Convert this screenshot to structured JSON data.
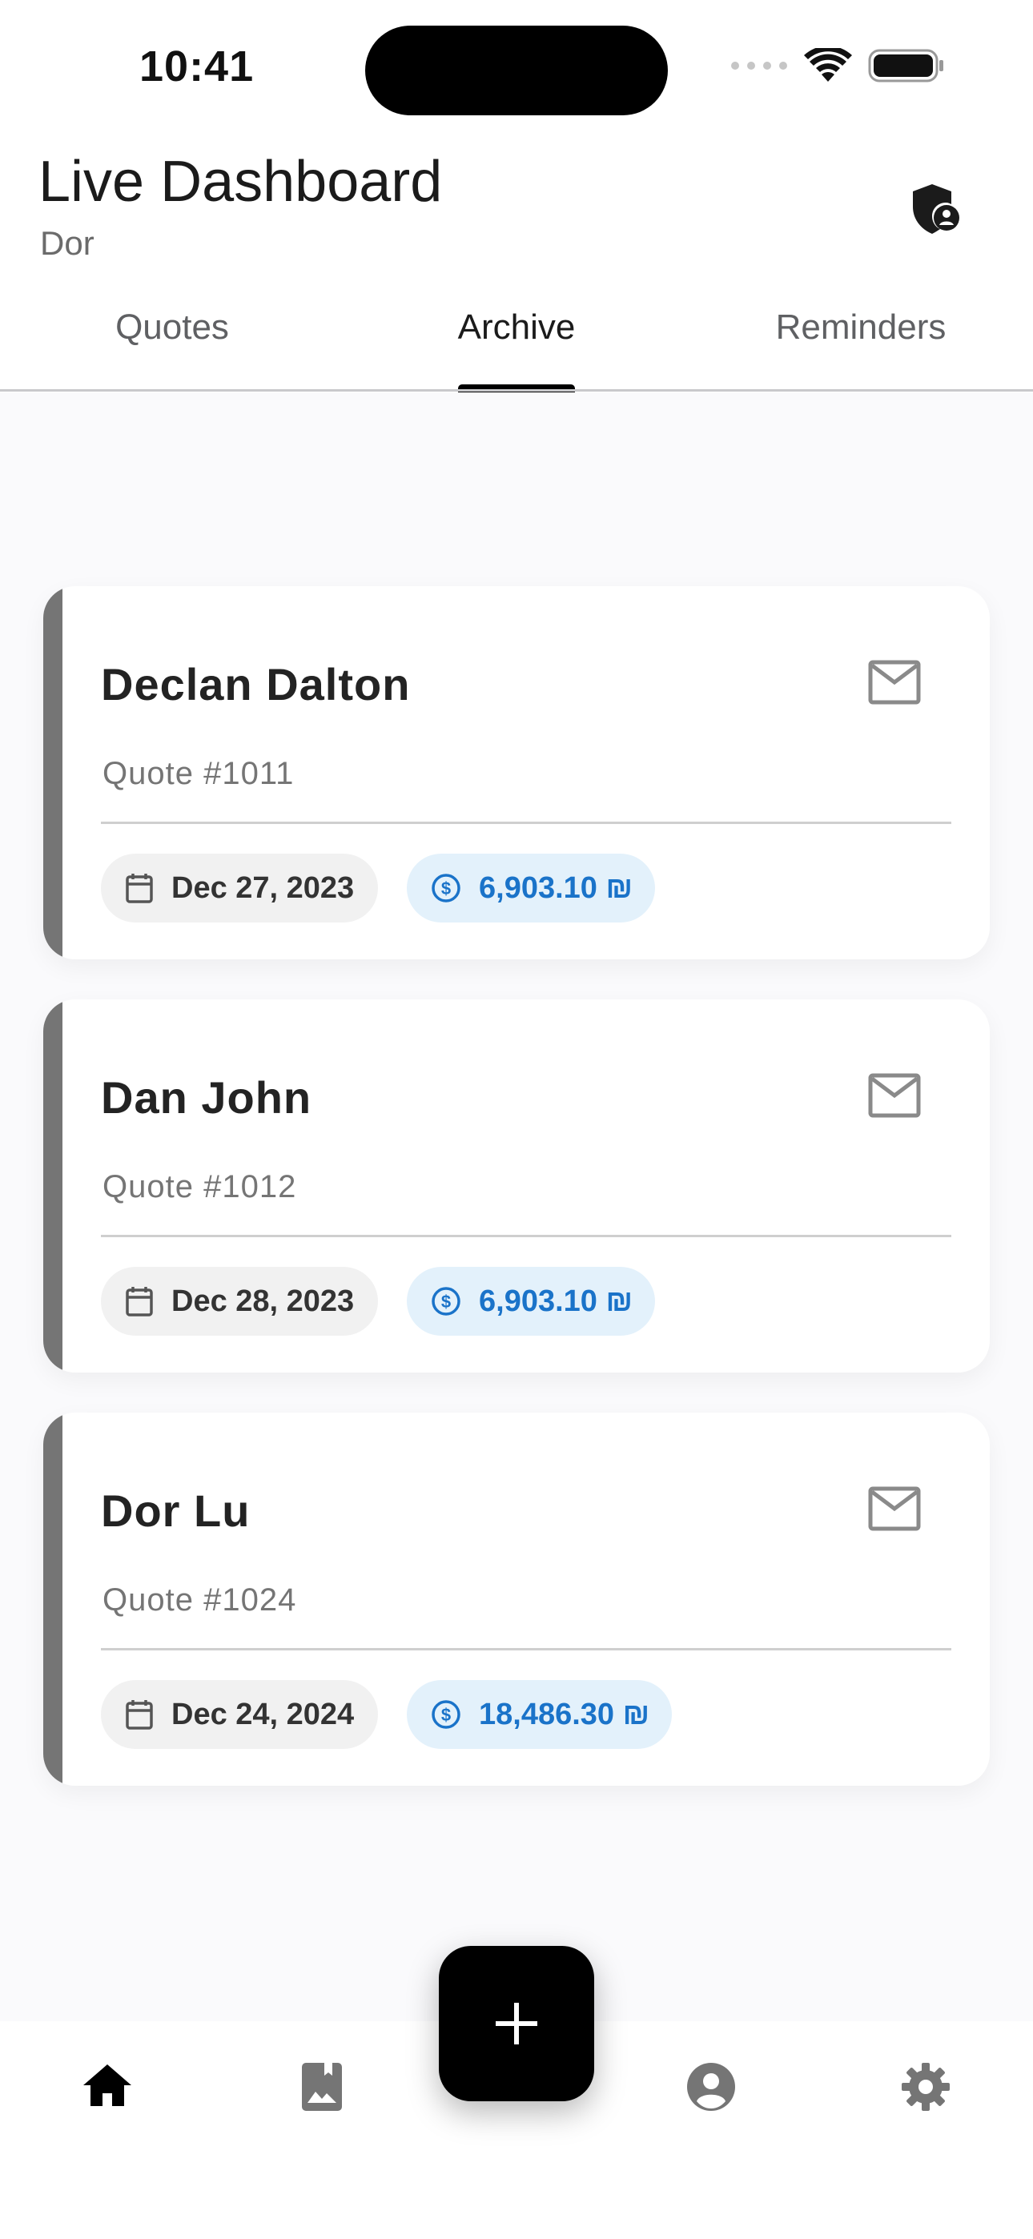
{
  "status_bar": {
    "time": "10:41"
  },
  "header": {
    "title": "Live Dashboard",
    "subtitle": "Dor"
  },
  "tabs": [
    {
      "label": "Quotes",
      "active": false
    },
    {
      "label": "Archive",
      "active": true
    },
    {
      "label": "Reminders",
      "active": false
    }
  ],
  "quotes": [
    {
      "name": "Declan Dalton",
      "quote_number": "Quote #1011",
      "date": "Dec 27, 2023",
      "amount": "6,903.10 ₪"
    },
    {
      "name": "Dan John",
      "quote_number": "Quote #1012",
      "date": "Dec 28, 2023",
      "amount": "6,903.10 ₪"
    },
    {
      "name": "Dor Lu",
      "quote_number": "Quote #1024",
      "date": "Dec 24, 2024",
      "amount": "18,486.30 ₪"
    }
  ],
  "bottom_nav": [
    {
      "icon": "home-icon",
      "active": true
    },
    {
      "icon": "bookmark-image-icon",
      "active": false
    },
    {
      "icon": "account-circle-icon",
      "active": false
    },
    {
      "icon": "settings-gear-icon",
      "active": false
    }
  ],
  "colors": {
    "accent_bar": "#757575",
    "amount_chip_bg": "#e3f1fb",
    "amount_chip_text": "#1a73c9",
    "fab": "#000000"
  }
}
